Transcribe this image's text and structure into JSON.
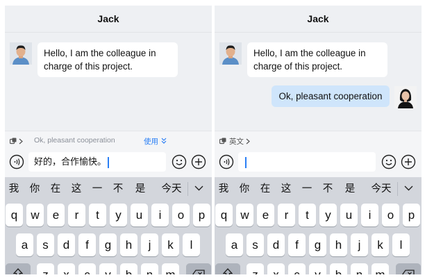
{
  "screens": [
    {
      "title": "Jack",
      "messages": [
        {
          "side": "in",
          "text": "Hello, I am the colleague in charge of this project."
        }
      ],
      "suggestion_text": "Ok, pleasant cooperation",
      "use_label": "使用",
      "input_value": "好的，合作愉快。"
    },
    {
      "title": "Jack",
      "messages": [
        {
          "side": "in",
          "text": "Hello, I am the colleague in charge of this project."
        },
        {
          "side": "out",
          "text": "Ok, pleasant cooperation"
        }
      ],
      "language_label": "英文",
      "input_value": ""
    }
  ],
  "keyboard": {
    "candidates": [
      "我",
      "你",
      "在",
      "这",
      "一",
      "不",
      "是",
      "今天"
    ],
    "rows": [
      [
        "q",
        "w",
        "e",
        "r",
        "t",
        "y",
        "u",
        "i",
        "o",
        "p"
      ],
      [
        "a",
        "s",
        "d",
        "f",
        "g",
        "h",
        "j",
        "k",
        "l"
      ],
      [
        "z",
        "x",
        "c",
        "v",
        "b",
        "n",
        "m"
      ]
    ]
  },
  "icons": {
    "strip_icon": "translate-icon",
    "chevron": "chevron-right-icon",
    "voice": "voice-icon",
    "emoji": "emoji-icon",
    "add": "plus-circle-icon",
    "collapse": "chevron-down-icon",
    "shift": "shift-icon",
    "backspace": "backspace-icon"
  },
  "colors": {
    "accent": "#2a7ff5",
    "chat_bg": "#eef0f3",
    "outgoing_bubble": "#cfe5fb",
    "keyboard_bg": "#d3d6dc"
  }
}
